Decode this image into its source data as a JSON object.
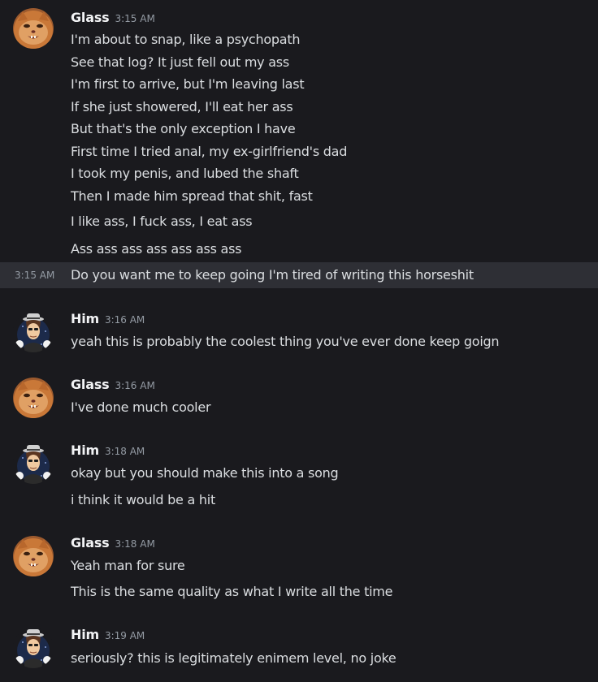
{
  "users": {
    "glass": {
      "name": "Glass",
      "avatar_icon": "orange-cat-icon"
    },
    "him": {
      "name": "Him",
      "avatar_icon": "fedora-cartoon-man-icon"
    }
  },
  "colors": {
    "background": "#1a1a1e",
    "hover_row": "#2e2f35",
    "username": "#f2f3f5",
    "text": "#dbdee1",
    "timestamp": "#949ba4"
  },
  "messages": [
    {
      "user": "Glass",
      "time": "3:15 AM",
      "lines": [
        "I'm about to snap, like a psychopath",
        "See that log? It just fell out my ass",
        "I'm first to arrive, but I'm leaving last",
        "If she just showered, I'll eat her ass",
        "But that's the only exception I have",
        "First time I tried anal, my ex-girlfriend's dad",
        "I took my penis, and lubed the shaft",
        "Then I made him spread that shit, fast",
        "I like ass, I fuck ass, I eat ass",
        "Ass ass ass ass ass ass ass",
        "Do you want me to keep going I'm tired of writing this horseshit"
      ],
      "hover_time": "3:15 AM"
    },
    {
      "user": "Him",
      "time": "3:16 AM",
      "lines": [
        "yeah this is probably the coolest thing you've ever done keep goign"
      ]
    },
    {
      "user": "Glass",
      "time": "3:16 AM",
      "lines": [
        "I've done much cooler"
      ]
    },
    {
      "user": "Him",
      "time": "3:18 AM",
      "lines": [
        "okay but you should make this into a song",
        "i think it would be a hit"
      ]
    },
    {
      "user": "Glass",
      "time": "3:18 AM",
      "lines": [
        "Yeah man for sure",
        "This is the same quality as what I write all the time"
      ]
    },
    {
      "user": "Him",
      "time": "3:19 AM",
      "lines": [
        "seriously? this is legitimately enimem level, no joke"
      ]
    }
  ]
}
